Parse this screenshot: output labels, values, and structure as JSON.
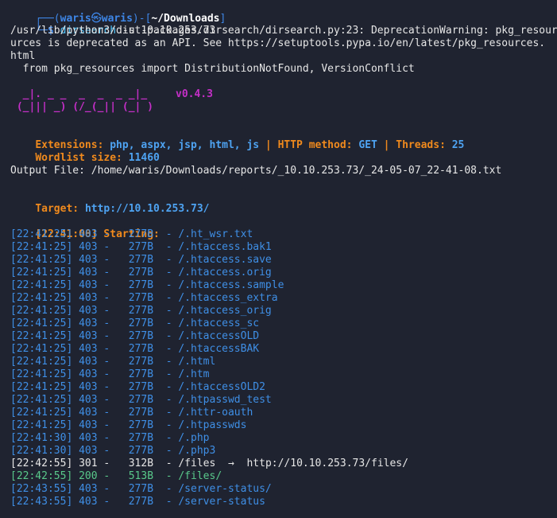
{
  "prompt": {
    "open": "┌──(",
    "user": "waris",
    "skull": "㉿",
    "host": "waris",
    "mid": ")-[",
    "path": "~/Downloads",
    "close": "]",
    "line2_prefix": "└─",
    "dollar": "$",
    "command_name": "dirsearch",
    "command_args": " -u 10.10.253.73"
  },
  "warning": [
    "/usr/lib/python3/dist-packages/dirsearch/dirsearch.py:23: DeprecationWarning: pkg_resour",
    "urces is deprecated as an API. See https://setuptools.pypa.io/en/latest/pkg_resources.",
    "html",
    "  from pkg_resources import DistributionNotFound, VersionConflict"
  ],
  "logo": {
    "line1": "  _|. _ _  _  _  _ _|_",
    "line2": " (_||| _) (/_(_|| (_| )",
    "version": "v0.4.3"
  },
  "config": {
    "extensions_label": "Extensions:",
    "extensions_value": "php, aspx, jsp, html, js",
    "sep": "|",
    "method_label": "HTTP method:",
    "method_value": "GET",
    "threads_label": "Threads:",
    "threads_value": "25",
    "wordlist_label": "Wordlist size:",
    "wordlist_value": "11460"
  },
  "output_file": "Output File: /home/waris/Downloads/reports/_10.10.253.73/_24-05-07_22-41-08.txt",
  "target": {
    "label": "Target:",
    "url": "http://10.10.253.73/"
  },
  "starting": {
    "time": "[22:41:08]",
    "label": "Starting:"
  },
  "results": [
    {
      "time": "[22:41:25]",
      "code": "403",
      "size": "277B",
      "path": "/.ht_wsr.txt",
      "redirect": ""
    },
    {
      "time": "[22:41:25]",
      "code": "403",
      "size": "277B",
      "path": "/.htaccess.bak1",
      "redirect": ""
    },
    {
      "time": "[22:41:25]",
      "code": "403",
      "size": "277B",
      "path": "/.htaccess.save",
      "redirect": ""
    },
    {
      "time": "[22:41:25]",
      "code": "403",
      "size": "277B",
      "path": "/.htaccess.orig",
      "redirect": ""
    },
    {
      "time": "[22:41:25]",
      "code": "403",
      "size": "277B",
      "path": "/.htaccess.sample",
      "redirect": ""
    },
    {
      "time": "[22:41:25]",
      "code": "403",
      "size": "277B",
      "path": "/.htaccess_extra",
      "redirect": ""
    },
    {
      "time": "[22:41:25]",
      "code": "403",
      "size": "277B",
      "path": "/.htaccess_orig",
      "redirect": ""
    },
    {
      "time": "[22:41:25]",
      "code": "403",
      "size": "277B",
      "path": "/.htaccess_sc",
      "redirect": ""
    },
    {
      "time": "[22:41:25]",
      "code": "403",
      "size": "277B",
      "path": "/.htaccessOLD",
      "redirect": ""
    },
    {
      "time": "[22:41:25]",
      "code": "403",
      "size": "277B",
      "path": "/.htaccessBAK",
      "redirect": ""
    },
    {
      "time": "[22:41:25]",
      "code": "403",
      "size": "277B",
      "path": "/.html",
      "redirect": ""
    },
    {
      "time": "[22:41:25]",
      "code": "403",
      "size": "277B",
      "path": "/.htm",
      "redirect": ""
    },
    {
      "time": "[22:41:25]",
      "code": "403",
      "size": "277B",
      "path": "/.htaccessOLD2",
      "redirect": ""
    },
    {
      "time": "[22:41:25]",
      "code": "403",
      "size": "277B",
      "path": "/.htpasswd_test",
      "redirect": ""
    },
    {
      "time": "[22:41:25]",
      "code": "403",
      "size": "277B",
      "path": "/.httr-oauth",
      "redirect": ""
    },
    {
      "time": "[22:41:25]",
      "code": "403",
      "size": "277B",
      "path": "/.htpasswds",
      "redirect": ""
    },
    {
      "time": "[22:41:30]",
      "code": "403",
      "size": "277B",
      "path": "/.php",
      "redirect": ""
    },
    {
      "time": "[22:41:30]",
      "code": "403",
      "size": "277B",
      "path": "/.php3",
      "redirect": ""
    },
    {
      "time": "[22:42:55]",
      "code": "301",
      "size": "312B",
      "path": "/files",
      "redirect": "http://10.10.253.73/files/"
    },
    {
      "time": "[22:42:55]",
      "code": "200",
      "size": "513B",
      "path": "/files/",
      "redirect": ""
    },
    {
      "time": "[22:43:55]",
      "code": "403",
      "size": "277B",
      "path": "/server-status/",
      "redirect": ""
    },
    {
      "time": "[22:43:55]",
      "code": "403",
      "size": "277B",
      "path": "/server-status",
      "redirect": ""
    }
  ],
  "row_colors": {
    "403": "#3f8fe6",
    "200": "#59c98b",
    "301": "#e6e6e6"
  }
}
